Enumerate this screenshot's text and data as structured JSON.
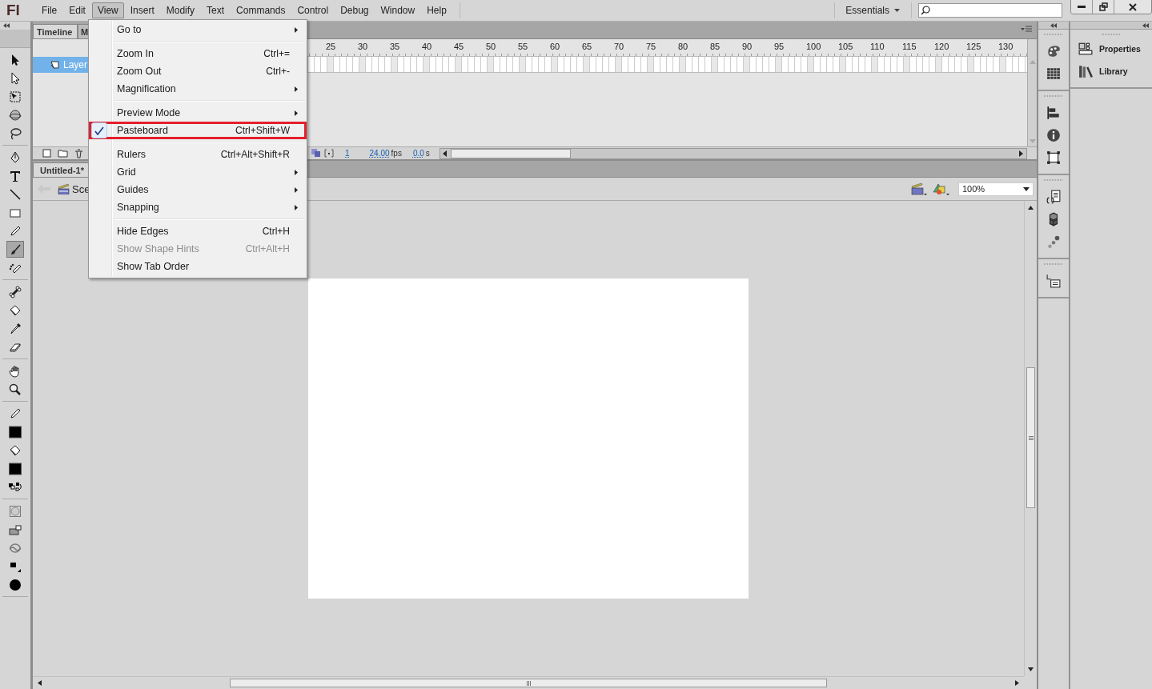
{
  "menubar": {
    "logo": "Fl",
    "menus": [
      {
        "label": "File",
        "selected": false
      },
      {
        "label": "Edit",
        "selected": false
      },
      {
        "label": "View",
        "selected": true
      },
      {
        "label": "Insert",
        "selected": false
      },
      {
        "label": "Modify",
        "selected": false
      },
      {
        "label": "Text",
        "selected": false
      },
      {
        "label": "Commands",
        "selected": false
      },
      {
        "label": "Control",
        "selected": false
      },
      {
        "label": "Debug",
        "selected": false
      },
      {
        "label": "Window",
        "selected": false
      },
      {
        "label": "Help",
        "selected": false
      }
    ],
    "workspace": "Essentials"
  },
  "tools": [
    [
      {
        "kind": "selection",
        "selected": false
      },
      {
        "kind": "subselection",
        "selected": false
      },
      {
        "kind": "free-transform",
        "selected": false
      },
      {
        "kind": "rotation-3d",
        "selected": false
      },
      {
        "kind": "lasso",
        "selected": false
      }
    ],
    [
      {
        "kind": "pen",
        "selected": false
      },
      {
        "kind": "text",
        "selected": false
      },
      {
        "kind": "line",
        "selected": false
      },
      {
        "kind": "rectangle",
        "selected": false
      },
      {
        "kind": "pencil",
        "selected": false
      },
      {
        "kind": "brush",
        "selected": true
      },
      {
        "kind": "deco",
        "selected": false
      }
    ],
    [
      {
        "kind": "bone",
        "selected": false
      },
      {
        "kind": "bucket",
        "selected": false
      },
      {
        "kind": "eyedropper",
        "selected": false
      },
      {
        "kind": "eraser",
        "selected": false
      }
    ],
    [
      {
        "kind": "hand",
        "selected": false
      },
      {
        "kind": "zoom",
        "selected": false
      }
    ],
    [
      {
        "kind": "stroke",
        "selected": false
      },
      {
        "kind": "swatch",
        "selected": false
      },
      {
        "kind": "fill",
        "selected": false
      },
      {
        "kind": "swatch",
        "selected": false
      },
      {
        "kind": "color-swap",
        "selected": false
      }
    ],
    [
      {
        "kind": "object-drawing",
        "selected": false
      },
      {
        "kind": "lock-fill",
        "selected": false
      },
      {
        "kind": "smooth",
        "selected": false
      },
      {
        "kind": "brush-size",
        "selected": false
      },
      {
        "kind": "brush-shape",
        "selected": false
      }
    ]
  ],
  "timeline": {
    "tabs": [
      {
        "label": "Timeline",
        "selected": true
      },
      {
        "label": "M",
        "selected": false
      }
    ],
    "layers": [
      {
        "name": "Layer",
        "selected": true
      }
    ],
    "ruler": [
      "25",
      "30",
      "35",
      "40",
      "45",
      "50",
      "55",
      "60",
      "65",
      "70",
      "75",
      "80",
      "85",
      "90",
      "95",
      "100",
      "105",
      "110",
      "115",
      "120",
      "125",
      "130"
    ],
    "current_frame": "1",
    "frame_rate": "24.00",
    "frame_rate_unit": "fps",
    "elapsed": "0.0",
    "elapsed_unit": "s"
  },
  "document": {
    "tab": "Untitled-1*",
    "scene": "Sce",
    "zoom": "100%"
  },
  "dock": {
    "groups": [
      [
        {
          "kind": "palette"
        },
        {
          "kind": "grid"
        }
      ],
      [
        {
          "kind": "align"
        },
        {
          "kind": "info"
        },
        {
          "kind": "transform"
        }
      ],
      [
        {
          "kind": "code"
        },
        {
          "kind": "components"
        },
        {
          "kind": "motion"
        }
      ],
      [
        {
          "kind": "history"
        }
      ]
    ]
  },
  "panel": {
    "items": [
      {
        "label": "Properties",
        "kind": "properties"
      },
      {
        "label": "Library",
        "kind": "library"
      }
    ]
  },
  "view_menu": {
    "items": [
      {
        "kind": "item",
        "label": "Go to",
        "submenu": true,
        "checked": false,
        "disabled": false,
        "highlighted": false
      },
      {
        "kind": "separator"
      },
      {
        "kind": "item",
        "label": "Zoom In",
        "shortcut": "Ctrl+=",
        "submenu": false,
        "checked": false,
        "disabled": false,
        "highlighted": false
      },
      {
        "kind": "item",
        "label": "Zoom Out",
        "shortcut": "Ctrl+-",
        "submenu": false,
        "checked": false,
        "disabled": false,
        "highlighted": false
      },
      {
        "kind": "item",
        "label": "Magnification",
        "submenu": true,
        "checked": false,
        "disabled": false,
        "highlighted": false
      },
      {
        "kind": "separator"
      },
      {
        "kind": "item",
        "label": "Preview Mode",
        "submenu": true,
        "checked": false,
        "disabled": false,
        "highlighted": false
      },
      {
        "kind": "item",
        "label": "Pasteboard",
        "shortcut": "Ctrl+Shift+W",
        "submenu": false,
        "checked": true,
        "disabled": false,
        "highlighted": true
      },
      {
        "kind": "separator"
      },
      {
        "kind": "item",
        "label": "Rulers",
        "shortcut": "Ctrl+Alt+Shift+R",
        "submenu": false,
        "checked": false,
        "disabled": false,
        "highlighted": false
      },
      {
        "kind": "item",
        "label": "Grid",
        "submenu": true,
        "checked": false,
        "disabled": false,
        "highlighted": false
      },
      {
        "kind": "item",
        "label": "Guides",
        "submenu": true,
        "checked": false,
        "disabled": false,
        "highlighted": false
      },
      {
        "kind": "item",
        "label": "Snapping",
        "submenu": true,
        "checked": false,
        "disabled": false,
        "highlighted": false
      },
      {
        "kind": "separator"
      },
      {
        "kind": "item",
        "label": "Hide Edges",
        "shortcut": "Ctrl+H",
        "submenu": false,
        "checked": false,
        "disabled": false,
        "highlighted": false
      },
      {
        "kind": "item",
        "label": "Show Shape Hints",
        "shortcut": "Ctrl+Alt+H",
        "submenu": false,
        "checked": false,
        "disabled": true,
        "highlighted": false
      },
      {
        "kind": "item",
        "label": "Show Tab Order",
        "submenu": false,
        "checked": false,
        "disabled": false,
        "highlighted": false
      }
    ]
  }
}
